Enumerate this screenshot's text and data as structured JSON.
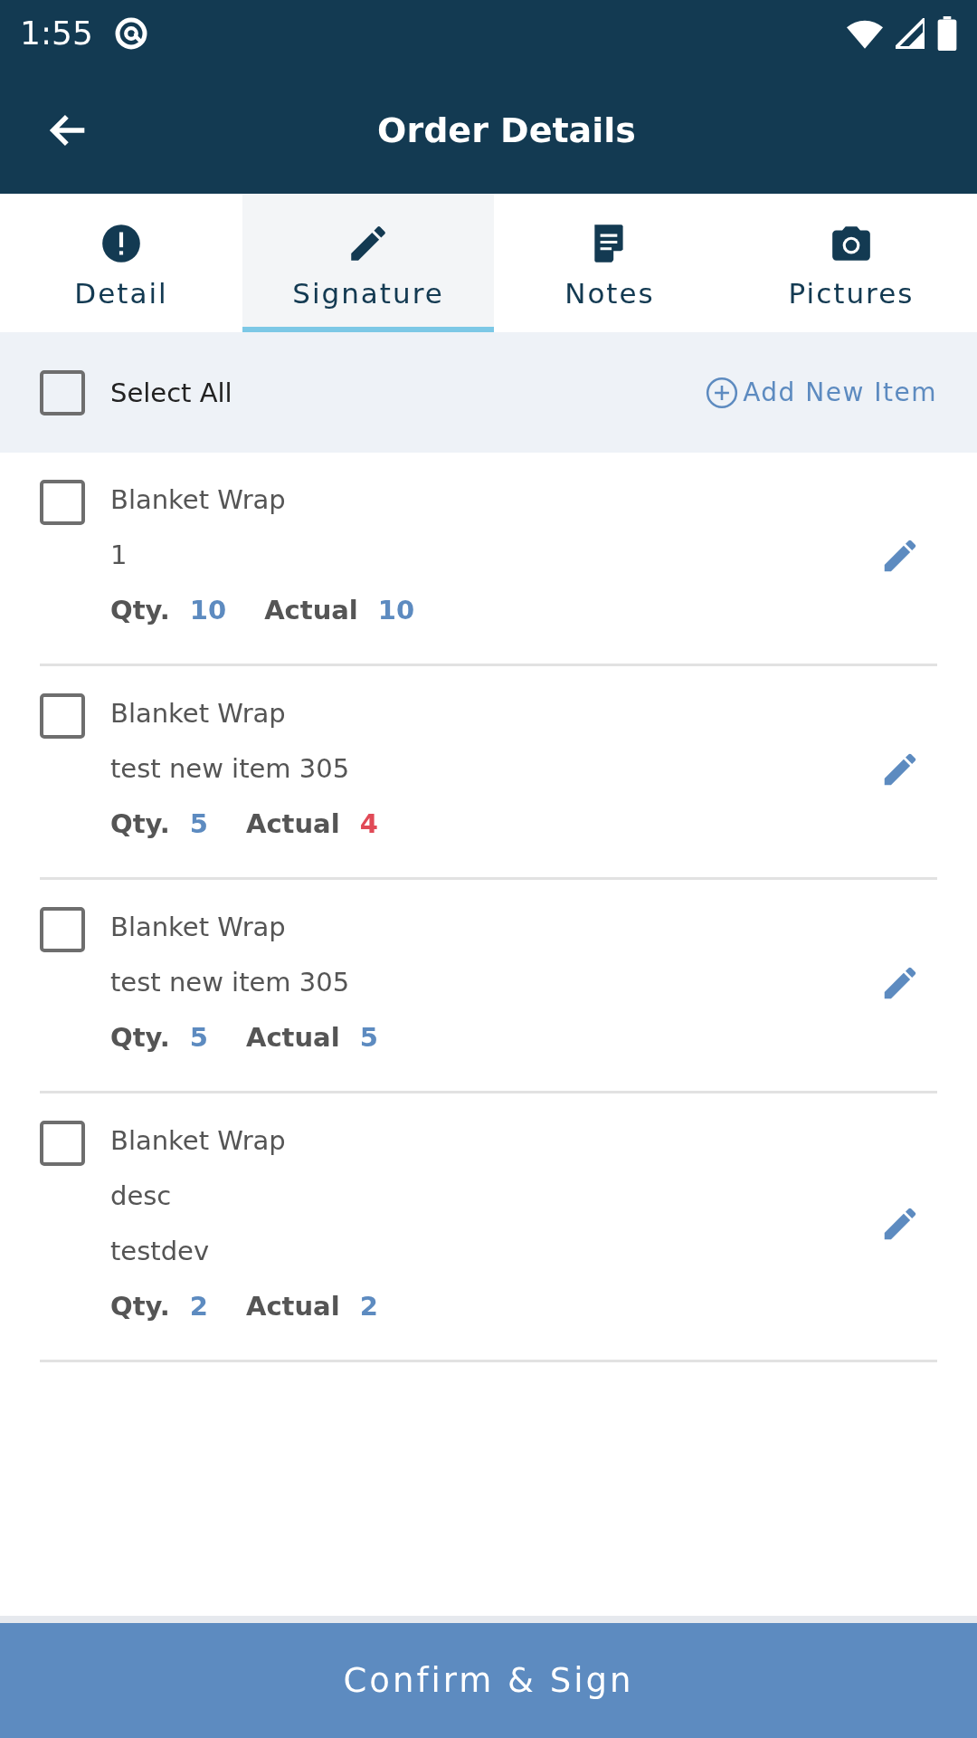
{
  "status_bar": {
    "time": "1:55"
  },
  "header": {
    "title": "Order Details"
  },
  "tabs": [
    {
      "label": "Detail",
      "selected": false
    },
    {
      "label": "Signature",
      "selected": true
    },
    {
      "label": "Notes",
      "selected": false
    },
    {
      "label": "Pictures",
      "selected": false
    }
  ],
  "select_all": {
    "label": "Select All",
    "checked": false
  },
  "add_item": {
    "label": "Add New Item"
  },
  "items": [
    {
      "name": "Blanket Wrap",
      "lines": [
        "1"
      ],
      "qty_label": "Qty.",
      "qty": "10",
      "actual_label": "Actual",
      "actual": "10",
      "mismatch": false,
      "checked": false
    },
    {
      "name": "Blanket Wrap",
      "lines": [
        "test new item 305"
      ],
      "qty_label": "Qty.",
      "qty": "5",
      "actual_label": "Actual",
      "actual": "4",
      "mismatch": true,
      "checked": false
    },
    {
      "name": "Blanket Wrap",
      "lines": [
        "test new item 305"
      ],
      "qty_label": "Qty.",
      "qty": "5",
      "actual_label": "Actual",
      "actual": "5",
      "mismatch": false,
      "checked": false
    },
    {
      "name": "Blanket Wrap",
      "lines": [
        "desc",
        "testdev"
      ],
      "qty_label": "Qty.",
      "qty": "2",
      "actual_label": "Actual",
      "actual": "2",
      "mismatch": false,
      "checked": false
    }
  ],
  "confirm_button": {
    "label": "Confirm & Sign"
  }
}
